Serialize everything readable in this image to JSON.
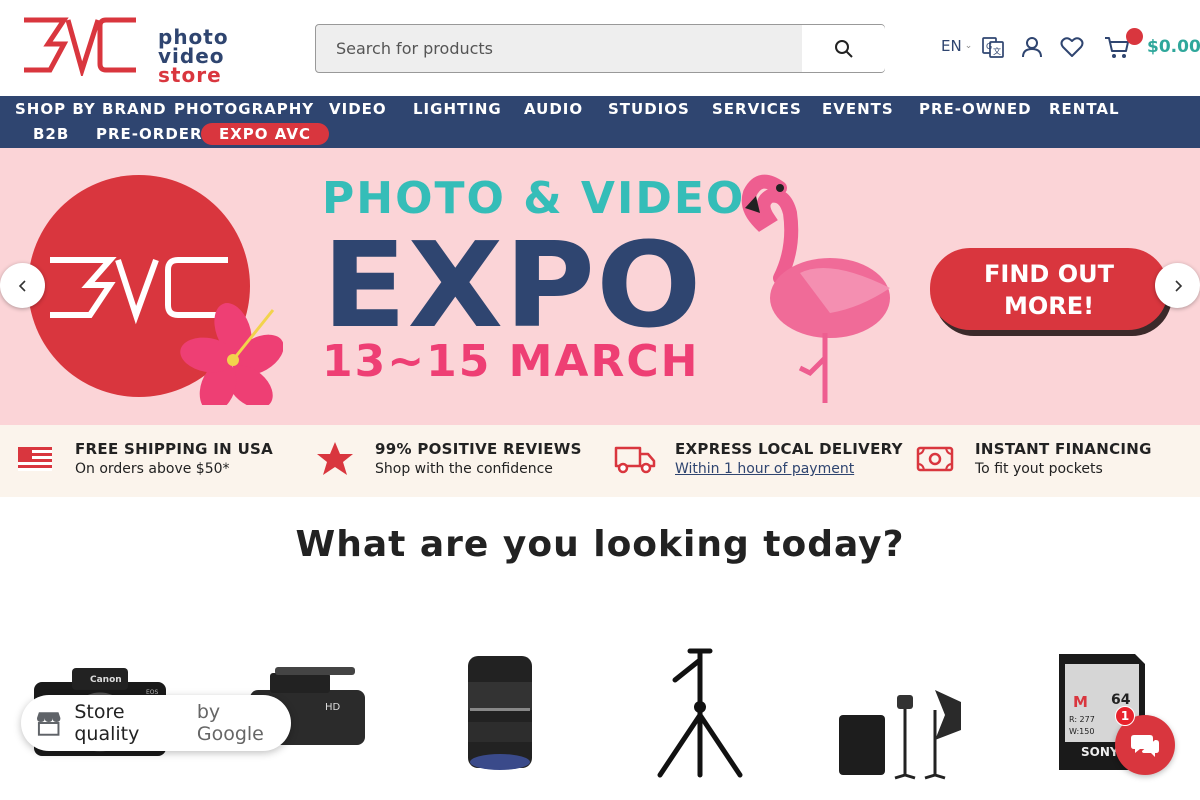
{
  "header": {
    "logo_lines": [
      "photo",
      "video",
      "store"
    ],
    "search_placeholder": "Search for products",
    "language": "EN",
    "cart_total": "$0.00"
  },
  "nav": {
    "items": [
      "SHOP BY BRAND",
      "PHOTOGRAPHY",
      "VIDEO",
      "LIGHTING",
      "AUDIO",
      "STUDIOS",
      "SERVICES",
      "EVENTS",
      "PRE-OWNED",
      "RENTAL",
      "B2B",
      "PRE-ORDER",
      "EXPO AVC"
    ]
  },
  "banner": {
    "line1": "PHOTO & VIDEO",
    "line2": "EXPO",
    "line3": "13~15 MARCH",
    "cta_line1": "FIND OUT",
    "cta_line2": "MORE!"
  },
  "features": [
    {
      "title": "FREE SHIPPING IN USA",
      "subtitle": "On orders above $50*",
      "icon": "us-flag-icon"
    },
    {
      "title": "99% POSITIVE REVIEWS",
      "subtitle": "Shop with the confidence",
      "icon": "star-icon"
    },
    {
      "title": "EXPRESS LOCAL DELIVERY",
      "subtitle": "Within 1 hour of payment",
      "icon": "truck-icon"
    },
    {
      "title": "INSTANT FINANCING",
      "subtitle": "To fit yout pockets",
      "icon": "money-icon"
    }
  ],
  "section_title": "What are you looking today?",
  "products": [
    {
      "icon": "camera-icon",
      "label": "Canon",
      "sub": "EOS"
    },
    {
      "icon": "camcorder-icon",
      "label": "HD"
    },
    {
      "icon": "lens-icon"
    },
    {
      "icon": "tripod-icon"
    },
    {
      "icon": "lighting-kit-icon"
    },
    {
      "icon": "memory-card-icon",
      "label": "SONY",
      "capacity": "64",
      "spec1": "R: 277",
      "spec2": "W:150"
    }
  ],
  "google_badge": {
    "label": "Store quality",
    "by": "by Google"
  },
  "chat": {
    "badge_count": "1"
  },
  "colors": {
    "navy": "#2f4570",
    "red": "#d9363e",
    "teal": "#2fa79b",
    "banner_bg": "#fbd4d7",
    "pink": "#ee3f74"
  }
}
